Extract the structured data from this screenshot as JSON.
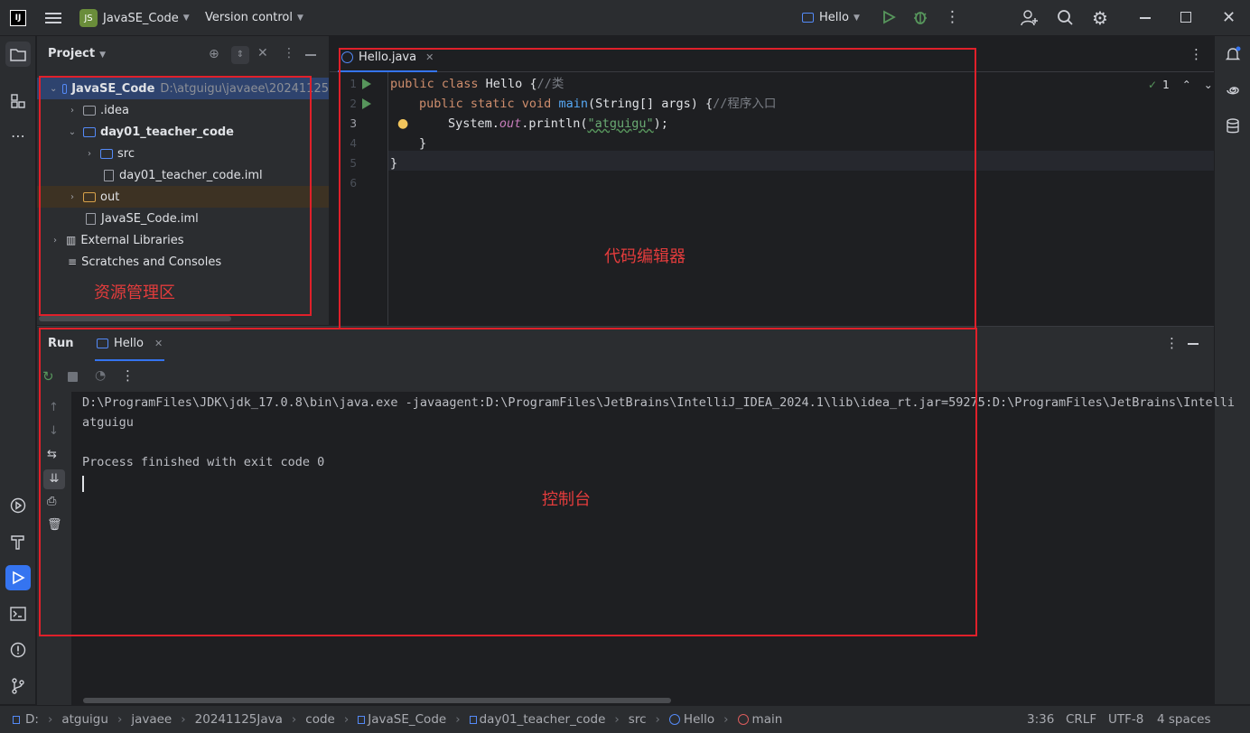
{
  "titlebar": {
    "logo": "IJ",
    "project_badge": "JS",
    "project_name": "JavaSE_Code",
    "vcs": "Version control",
    "run_config": "Hello"
  },
  "project_panel": {
    "title": "Project",
    "root": {
      "name": "JavaSE_Code",
      "path": "D:\\atguigu\\javaee\\20241125"
    },
    "items": [
      {
        "label": ".idea"
      },
      {
        "label": "day01_teacher_code"
      },
      {
        "label": "src"
      },
      {
        "label": "day01_teacher_code.iml"
      },
      {
        "label": "out"
      },
      {
        "label": "JavaSE_Code.iml"
      },
      {
        "label": "External Libraries"
      },
      {
        "label": "Scratches and Consoles"
      }
    ]
  },
  "editor": {
    "tab": "Hello.java",
    "inspection_count": "1",
    "line_numbers": [
      "1",
      "2",
      "3",
      "4",
      "5",
      "6"
    ],
    "code": {
      "l1_kw": "public class",
      "l1_name": " Hello {",
      "l1_comment": "//类",
      "l2_kw": "public static void",
      "l2_fn": "main",
      "l2_rest": "(String[] args) {",
      "l2_comment": "//程序入口",
      "l3_a": "System.",
      "l3_out": "out",
      "l3_b": ".println(",
      "l3_str": "\"atguigu\"",
      "l3_c": ");",
      "l4": "}",
      "l5": "}"
    }
  },
  "run_panel": {
    "title": "Run",
    "tab": "Hello",
    "output": [
      "D:\\ProgramFiles\\JDK\\jdk_17.0.8\\bin\\java.exe -javaagent:D:\\ProgramFiles\\JetBrains\\IntelliJ_IDEA_2024.1\\lib\\idea_rt.jar=59275:D:\\ProgramFiles\\JetBrains\\Intelli",
      "atguigu",
      "",
      "Process finished with exit code 0"
    ]
  },
  "annotations": {
    "project_area": "资源管理区",
    "editor_area": "代码编辑器",
    "console_area": "控制台"
  },
  "statusbar": {
    "crumbs": [
      "D:",
      "atguigu",
      "javaee",
      "20241125Java",
      "code",
      "JavaSE_Code",
      "day01_teacher_code",
      "src",
      "Hello",
      "main"
    ],
    "position": "3:36",
    "line_sep": "CRLF",
    "encoding": "UTF-8",
    "indent": "4 spaces"
  },
  "colors": {
    "accent": "#3574f0",
    "annotation": "#e0202a"
  }
}
